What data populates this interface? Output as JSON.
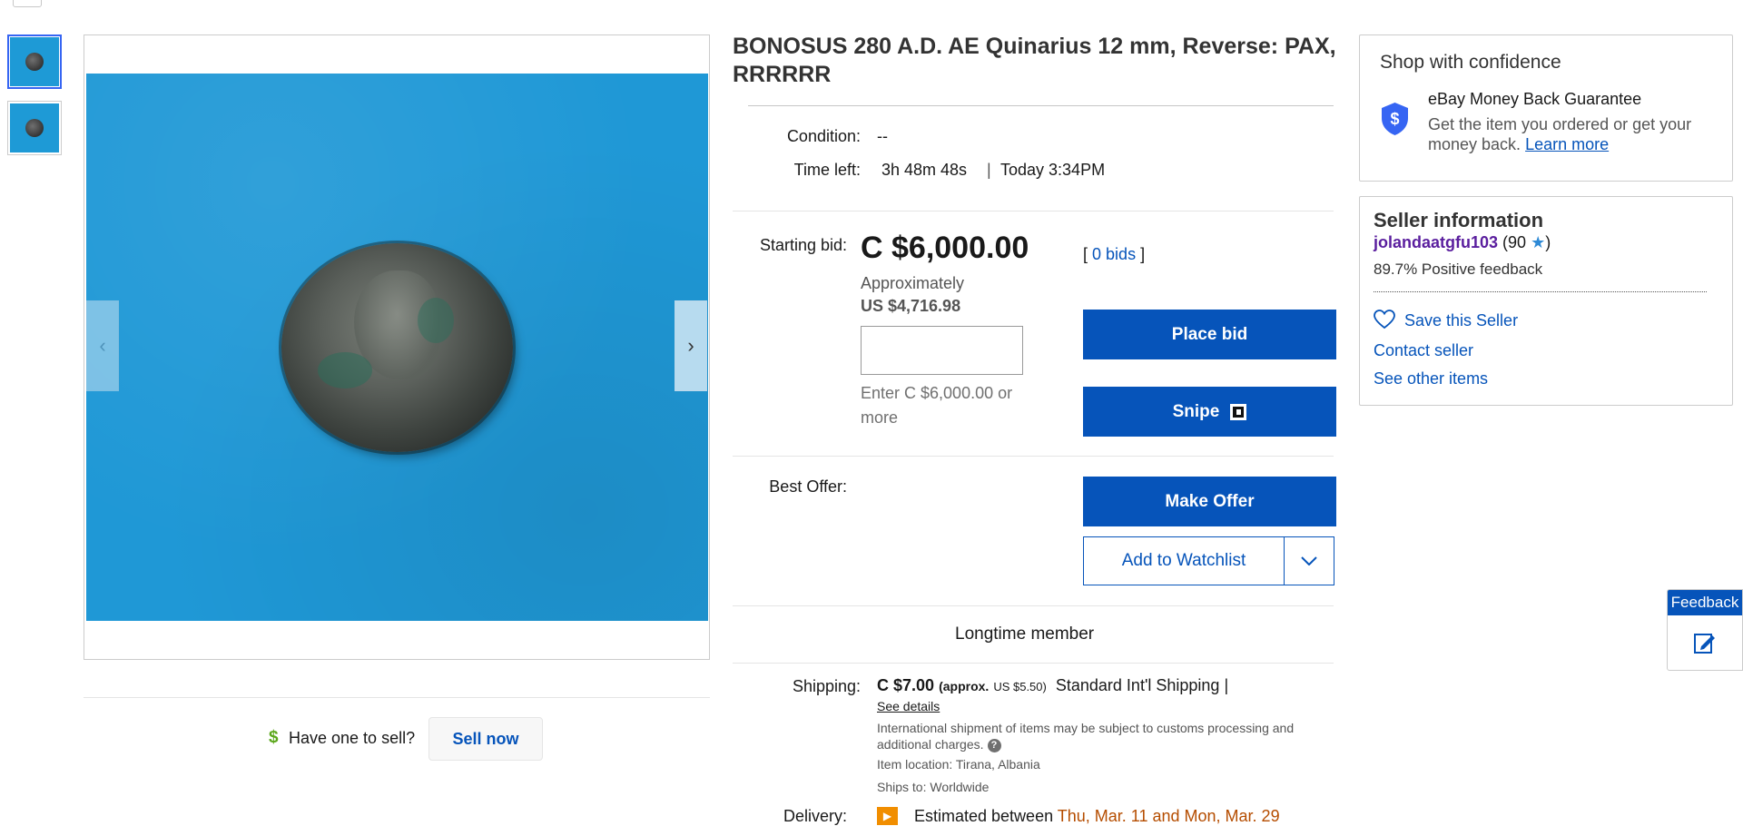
{
  "gallery": {
    "thumbnail_count": 2,
    "selected_thumbnail": 1
  },
  "sell": {
    "question": "Have one to sell?",
    "button": "Sell now",
    "icon": "dollar-icon"
  },
  "listing": {
    "title": "BONOSUS 280 A.D. AE Quinarius 12 mm, Reverse: PAX, RRRRRR",
    "condition_label": "Condition:",
    "condition_value": "--",
    "time_left_label": "Time left:",
    "time_left_value": "3h 48m 48s",
    "end_time": "Today 3:34PM",
    "separator": "|",
    "starting_bid_label": "Starting bid:",
    "starting_bid": "C $6,000.00",
    "approximately": "Approximately",
    "usd_price": "US $4,716.98",
    "bids_open": "[",
    "bids_count": "0 bids",
    "bids_close": "]",
    "bid_input_value": "",
    "bid_hint": "Enter C $6,000.00 or more",
    "place_bid": "Place bid",
    "snipe": "Snipe",
    "best_offer_label": "Best Offer:",
    "make_offer": "Make Offer",
    "add_to_watchlist": "Add to Watchlist",
    "longtime_member": "Longtime member"
  },
  "shipping": {
    "label": "Shipping:",
    "price": "C $7.00",
    "approx_label": "(approx.",
    "approx_usd": "US $5.50)",
    "service": "Standard Int'l Shipping |",
    "see_details": "See details",
    "international_note": "International shipment of items may be subject to customs processing and additional charges.",
    "item_location": "Item location:  Tirana, Albania",
    "ships_to": "Ships to:  Worldwide",
    "delivery_label": "Delivery:",
    "delivery_prefix": "Estimated between",
    "delivery_dates": "Thu, Mar. 11 and Mon, Mar. 29"
  },
  "confidence": {
    "title": "Shop with confidence",
    "guarantee_title": "eBay Money Back Guarantee",
    "guarantee_text": "Get the item you ordered or get your money back.",
    "learn_more": "Learn more"
  },
  "seller": {
    "title": "Seller information",
    "name": "jolandaatgfu103",
    "score_open": "(90",
    "score_close": ")",
    "positive": "89.7% Positive feedback",
    "save": "Save this Seller",
    "contact": "Contact seller",
    "other_items": "See other items"
  },
  "feedback_tab": {
    "label": "Feedback"
  },
  "colors": {
    "ebay_blue": "#0654ba",
    "photo_background": "#1f98d6",
    "seller_name": "#5a1e9e",
    "delivery_orange": "#b54d00"
  }
}
